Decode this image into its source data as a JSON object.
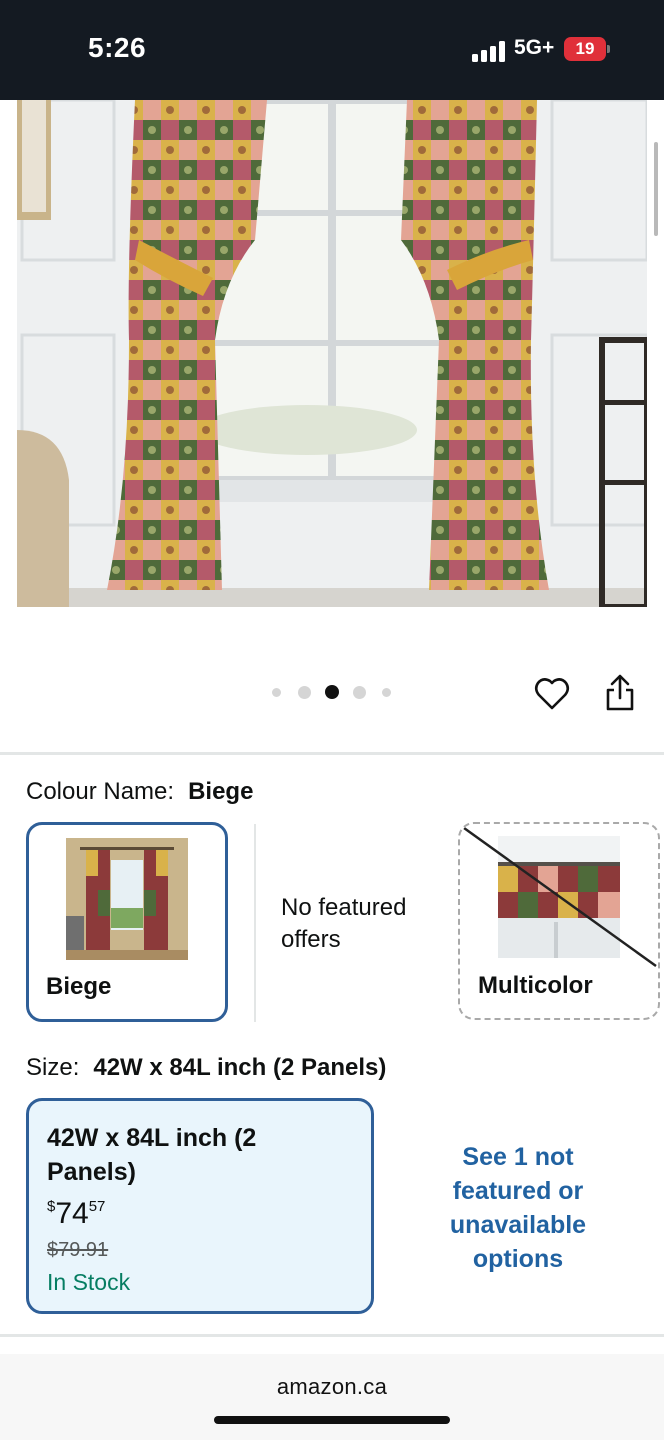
{
  "status_bar": {
    "time": "5:26",
    "network": "5G+",
    "battery": "19"
  },
  "product": {
    "image_icon": "curtain-photo",
    "carousel": {
      "count": 5,
      "active_index": 2
    }
  },
  "colour": {
    "label": "Colour Name:",
    "value": "Biege",
    "options": [
      {
        "label": "Biege",
        "selected": true
      },
      {
        "label": "No featured offers"
      },
      {
        "label": "Multicolor",
        "unavailable": true
      }
    ]
  },
  "size": {
    "label": "Size:",
    "value": "42W x 84L inch (2 Panels)",
    "option": {
      "name": "42W x 84L inch (2 Panels)",
      "currency": "$",
      "price_whole": "74",
      "price_cents": "57",
      "old_price": "$79.91",
      "stock": "In Stock"
    },
    "more_link": "See 1 not featured or unavailable options"
  },
  "footer": {
    "domain": "amazon.ca"
  },
  "colors": {
    "accent_border": "#2f5f98",
    "link": "#2162a1",
    "in_stock": "#067d62",
    "status_bar_bg": "#141a22"
  }
}
